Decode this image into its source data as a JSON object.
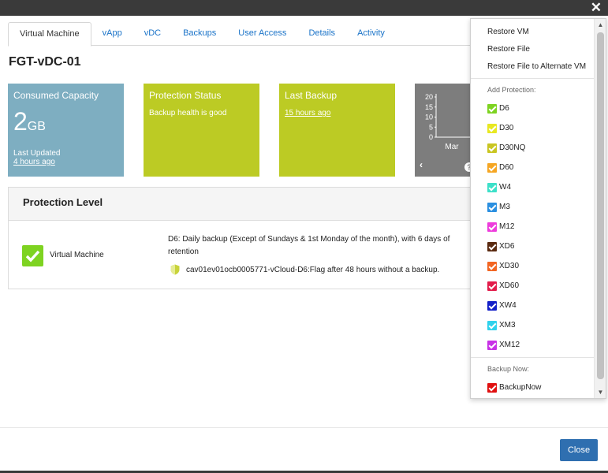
{
  "window": {
    "close_icon": "close-icon"
  },
  "tabs": [
    {
      "label": "Virtual Machine",
      "active": true
    },
    {
      "label": "vApp"
    },
    {
      "label": "vDC"
    },
    {
      "label": "Backups"
    },
    {
      "label": "User Access"
    },
    {
      "label": "Details"
    },
    {
      "label": "Activity"
    }
  ],
  "page_title": "FGT-vDC-01",
  "tiles": {
    "capacity": {
      "title": "Consumed Capacity",
      "value": "2",
      "unit": "GB",
      "updated_label": "Last Updated",
      "updated_value": "4 hours ago",
      "color": "#7eaec1"
    },
    "protection": {
      "title": "Protection Status",
      "text": "Backup health is good",
      "color": "#bccb24"
    },
    "backup": {
      "title": "Last Backup",
      "text": "15 hours ago",
      "color": "#bccb24"
    },
    "chart": {
      "color": "#7d7d7d",
      "prev_icon": "chevron-left-icon",
      "help_icon": "help-icon"
    }
  },
  "chart_data": {
    "type": "bar",
    "categories": [
      "Mar"
    ],
    "values": [],
    "title": "",
    "xlabel": "",
    "ylabel": "",
    "yticks": [
      "20",
      "15",
      "10",
      "5",
      "0"
    ],
    "ylim": [
      0,
      20
    ]
  },
  "protection_level": {
    "title": "Protection Level",
    "item_label": "Virtual Machine",
    "description": "D6: Daily backup (Except of Sundays & 1st Monday of the month), with 6 days of retention",
    "flag_text": "cav01ev01ocb0005771-vCloud-D6:Flag after 48 hours without a backup."
  },
  "dropdown": {
    "actions": [
      "Restore VM",
      "Restore File",
      "Restore File to Alternate VM"
    ],
    "add_protection_header": "Add Protection:",
    "protections": [
      {
        "label": "D6",
        "color": "#7ed321"
      },
      {
        "label": "D30",
        "color": "#e8e822"
      },
      {
        "label": "D30NQ",
        "color": "#c9c521"
      },
      {
        "label": "D60",
        "color": "#f5a623"
      },
      {
        "label": "W4",
        "color": "#3de0c9"
      },
      {
        "label": "M3",
        "color": "#2b8fe0"
      },
      {
        "label": "M12",
        "color": "#ee3cdc"
      },
      {
        "label": "XD6",
        "color": "#5a2a10"
      },
      {
        "label": "XD30",
        "color": "#f26522"
      },
      {
        "label": "XD60",
        "color": "#e21c4a"
      },
      {
        "label": "XW4",
        "color": "#1420c8"
      },
      {
        "label": "XM3",
        "color": "#2fd2ec"
      },
      {
        "label": "XM12",
        "color": "#c832e6"
      }
    ],
    "backup_now_header": "Backup Now:",
    "backup_now": [
      {
        "label": "BackupNow",
        "color": "#e01010"
      }
    ]
  },
  "footer": {
    "close_label": "Close",
    "close_color": "#2f6fb0"
  }
}
